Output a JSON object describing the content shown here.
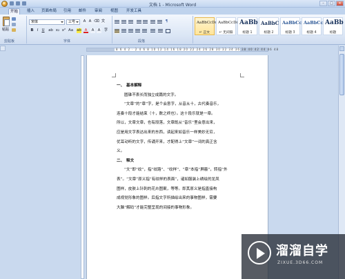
{
  "window": {
    "title": "文档 1 - Microsoft Word",
    "min_label": "–",
    "max_label": "□",
    "close_label": "×"
  },
  "tabs": [
    "开始",
    "插入",
    "页面布局",
    "引用",
    "邮件",
    "审阅",
    "视图",
    "开发工具"
  ],
  "ribbon": {
    "paste_label": "粘贴",
    "font_name": "宋体",
    "font_size": "三号",
    "bold": "B",
    "italic": "I",
    "underline": "U",
    "font_color_glyph": "A",
    "group_clipboard": "剪贴板",
    "group_font": "字体",
    "group_paragraph": "段落",
    "styles": [
      {
        "sample": "AaBbCcDd",
        "name": "↵ 正文"
      },
      {
        "sample": "AaBbCcDd",
        "name": "↵ 无间隔"
      },
      {
        "sample": "AaBb",
        "name": "标题 1"
      },
      {
        "sample": "AaBbC",
        "name": "标题 2"
      },
      {
        "sample": "AaBbCc",
        "name": "标题 3"
      },
      {
        "sample": "AaBbCc",
        "name": "标题 4"
      },
      {
        "sample": "AaBb",
        "name": "标题"
      }
    ]
  },
  "ruler": {
    "numbers": "8 6 4 2 · 2 4 6 8 10 12 14 16 18 20 22 24 26 28 30 32 34 36 38 40 42 44 46 48"
  },
  "document": {
    "heading1_num": "一、",
    "heading1": "基本解释",
    "lines1": [
      "圆锥不表长而独立成篇的文字。",
      "“文章”的“章”字，是个会意字，从音从十，古代奏音乐，",
      "连奏十段才能结束（十，数之终也）。这十段乐就是一章。",
      "所以，文章文章，也有段落，文章既从“音乐”里会意出来，",
      "应是用文字表达出来的东西，读起来如音乐一样美妙无穷，",
      "优耳动听的文字，传诵开来，才配得上“文章”一词的真正含",
      "义。"
    ],
    "heading2_num": "二、",
    "heading2": "释文",
    "lines2": [
      "“文”即“纹”，指“纹路”、“纹样”、“章”本指“屏蔽”，转指“外",
      "表”。“文章”原义指“有纹样的表面”，诸如服装上绣绘的龙凤",
      "图样，皮肤上针刺的花卉图案，等等。即其原义是指直接构",
      "成视觉形象的图样。后指文字所描绘出来的事物图样，需要",
      "大脑“解码”才能完整呈现的间接的事物形象。"
    ]
  },
  "watermark": {
    "brand": "溜溜自学",
    "url": "ZIXUE.3D66.COM"
  }
}
